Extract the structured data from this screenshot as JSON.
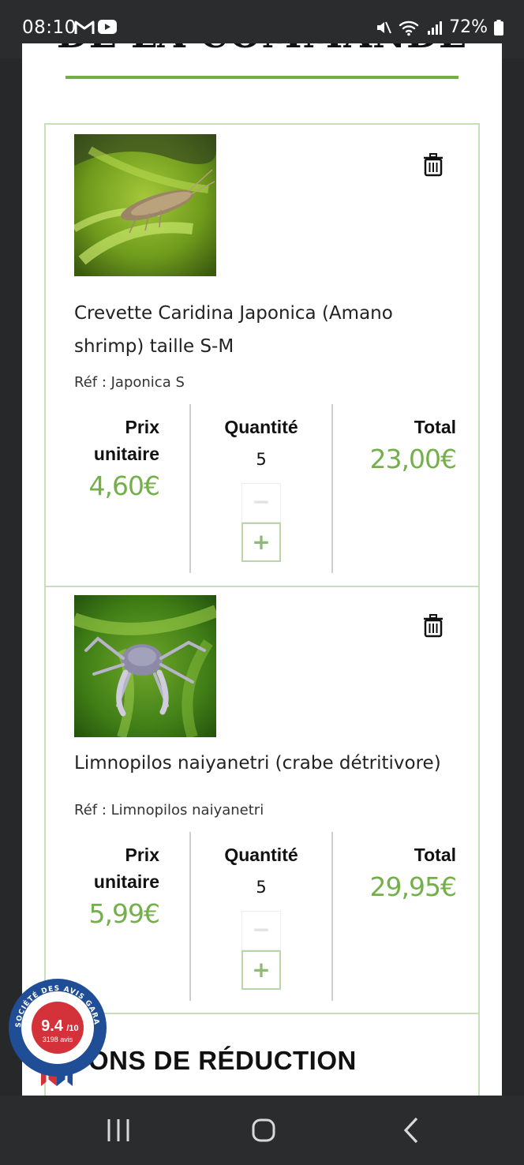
{
  "status_bar": {
    "time": "08:10",
    "battery": "72%"
  },
  "page": {
    "heading": "DE LA COMMANDE",
    "accent_color": "#72b043",
    "price_color": "#74b04a"
  },
  "cart": {
    "columns": {
      "unit_price_line1": "Prix",
      "unit_price_line2": "unitaire",
      "quantity": "Quantité",
      "total": "Total"
    },
    "items": [
      {
        "name": "Crevette Caridina Japonica (Amano shrimp) taille S-M",
        "ref": "Réf : Japonica S",
        "unit_price": "4,60€",
        "quantity": "5",
        "total": "23,00€",
        "stepper_minus": "−",
        "stepper_plus": "+",
        "image": "shrimp-photo"
      },
      {
        "name": "Limnopilos naiyanetri (crabe détritivore)",
        "ref": "Réf : Limnopilos naiyanetri",
        "unit_price": "5,99€",
        "quantity": "5",
        "total": "29,95€",
        "stepper_minus": "−",
        "stepper_plus": "+",
        "image": "crab-photo"
      }
    ]
  },
  "coupons": {
    "title": "ONS DE RÉDUCTION"
  },
  "badge": {
    "arc_text": "SOCIÉTÉ DES AVIS GARANTIS",
    "score": "9.4",
    "scale": "/10",
    "reviews": "3198 avis"
  },
  "icons": {
    "trash": "trash-icon",
    "mail": "gmail-icon",
    "youtube": "youtube-icon",
    "mute": "mute-icon",
    "wifi": "wifi-icon",
    "signal": "signal-icon",
    "battery": "battery-icon"
  }
}
